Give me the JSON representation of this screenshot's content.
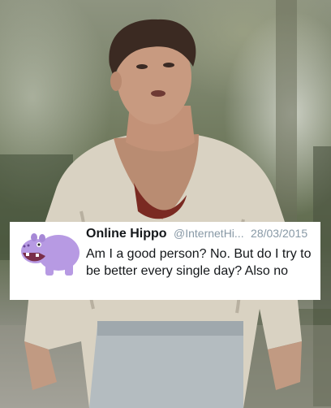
{
  "tweet": {
    "display_name": "Online Hippo",
    "handle": "@InternetHi...",
    "date": "28/03/2015",
    "text": "Am I a good person? No. But do I try to be better every single day? Also no",
    "avatar_icon": "purple-hippo-icon"
  },
  "photo": {
    "subject": "man-in-torn-bloody-shirt"
  },
  "colors": {
    "name": "#14171a",
    "meta": "#8899a6",
    "hippo": "#b79ae3"
  }
}
